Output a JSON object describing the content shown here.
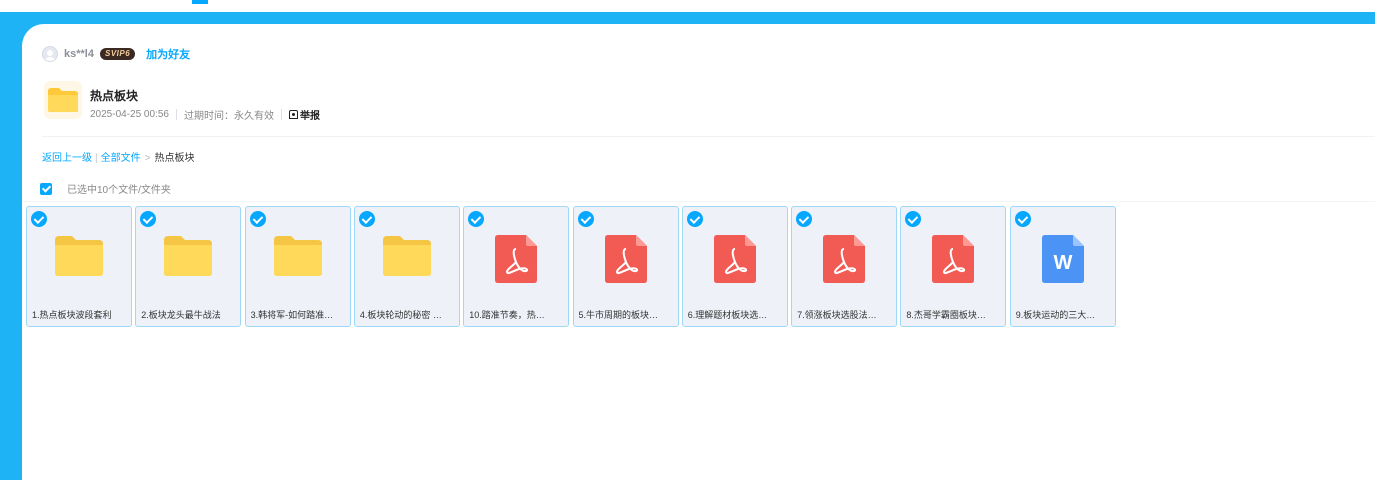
{
  "colors": {
    "accent": "#06a7ff",
    "frame": "#1eb3f4",
    "folder": "#ffd95a",
    "pdf": "#f25a54",
    "word": "#4b93f5"
  },
  "user": {
    "name": "ks**l4",
    "badge": "SVIP6",
    "add_friend": "加为好友"
  },
  "share": {
    "title": "热点板块",
    "date": "2025-04-25 00:56",
    "expire": "过期时间：永久有效",
    "report": "举报"
  },
  "breadcrumb": {
    "back": "返回上一级",
    "pipe": "|",
    "all": "全部文件",
    "sep": ">",
    "current": "热点板块"
  },
  "selection": {
    "text": "已选中10个文件/文件夹"
  },
  "files": [
    {
      "name": "1.热点板块波段套利",
      "type": "folder"
    },
    {
      "name": "2.板块龙头最牛战法",
      "type": "folder"
    },
    {
      "name": "3.韩将军-如何踏准…",
      "type": "folder"
    },
    {
      "name": "4.板块轮动的秘密 …",
      "type": "folder"
    },
    {
      "name": "10.踏准节奏，热…",
      "type": "pdf"
    },
    {
      "name": "5.牛市周期的板块…",
      "type": "pdf"
    },
    {
      "name": "6.理解题材板块选…",
      "type": "pdf"
    },
    {
      "name": "7.领涨板块选股法…",
      "type": "pdf"
    },
    {
      "name": "8.杰哥学霸圈板块…",
      "type": "pdf"
    },
    {
      "name": "9.板块运动的三大…",
      "type": "word",
      "icon_letter": "W"
    }
  ]
}
